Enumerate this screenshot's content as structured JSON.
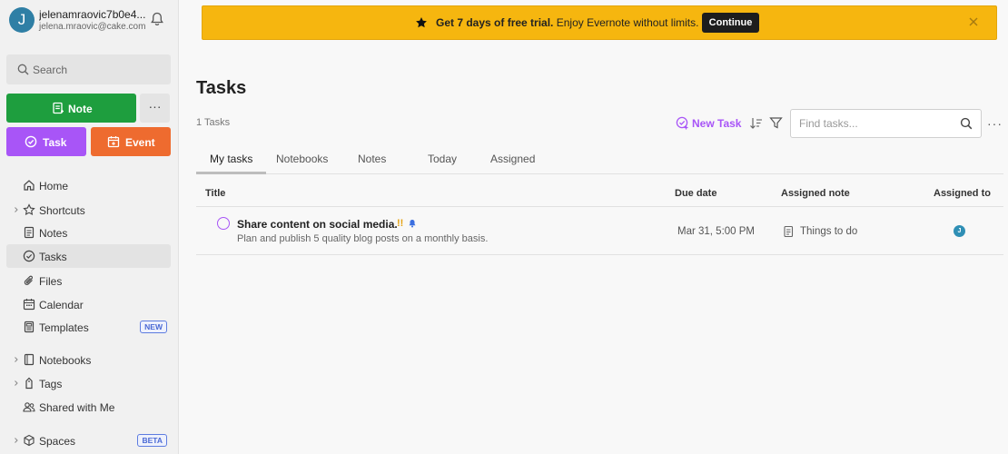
{
  "account": {
    "initial": "J",
    "name": "jelenamraovic7b0e4...",
    "email": "jelena.mraovic@cake.com"
  },
  "sidebar": {
    "search_label": "Search",
    "note_button": "Note",
    "more_button": "···",
    "task_button": "Task",
    "event_button": "Event",
    "items": [
      {
        "label": "Home",
        "icon": "home-icon"
      },
      {
        "label": "Shortcuts",
        "icon": "star-icon"
      },
      {
        "label": "Notes",
        "icon": "notes-icon"
      },
      {
        "label": "Tasks",
        "icon": "check-circle-icon",
        "active": true
      },
      {
        "label": "Files",
        "icon": "paperclip-icon"
      },
      {
        "label": "Calendar",
        "icon": "calendar-icon"
      },
      {
        "label": "Templates",
        "icon": "template-icon",
        "badge": "NEW"
      },
      {
        "label": "Notebooks",
        "icon": "notebook-icon"
      },
      {
        "label": "Tags",
        "icon": "tag-icon"
      },
      {
        "label": "Shared with Me",
        "icon": "people-icon"
      },
      {
        "label": "Spaces",
        "icon": "cube-icon",
        "badge": "BETA"
      }
    ]
  },
  "banner": {
    "bold": "Get 7 days of free trial.",
    "text": " Enjoy Evernote without limits.",
    "button": "Continue",
    "color": "#f6b60f"
  },
  "main": {
    "title": "Tasks",
    "count": "1 Tasks",
    "new_task": "New Task",
    "find_placeholder": "Find tasks...",
    "tabs": [
      "My tasks",
      "Notebooks",
      "Notes",
      "Today",
      "Assigned"
    ],
    "columns": {
      "title": "Title",
      "due": "Due date",
      "note": "Assigned note",
      "assigned": "Assigned to"
    },
    "tasks": [
      {
        "title": "Share content on social media.",
        "flag": "!!",
        "description": "Plan and publish 5 quality blog posts on a monthly basis.",
        "due": "Mar 31, 5:00 PM",
        "note": "Things to do",
        "assignee_initial": "J"
      }
    ]
  },
  "colors": {
    "accent_purple": "#a855f7",
    "note_green": "#1e9e3e",
    "event_orange": "#ee6b2f"
  }
}
